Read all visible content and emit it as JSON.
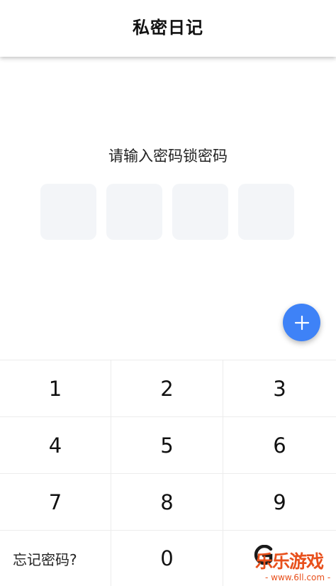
{
  "header": {
    "title": "私密日记"
  },
  "lock": {
    "prompt": "请输入密码锁密码",
    "pin_length": 4
  },
  "fab": {
    "icon": "plus-icon",
    "color": "#3e82f7"
  },
  "keypad": {
    "keys": [
      "1",
      "2",
      "3",
      "4",
      "5",
      "6",
      "7",
      "8",
      "9"
    ],
    "forgot_label": "忘记密码?",
    "zero": "0"
  },
  "watermark": {
    "brand": "乐乐游戏",
    "url": "- www.6ll.com -",
    "color": "#e8501c"
  }
}
